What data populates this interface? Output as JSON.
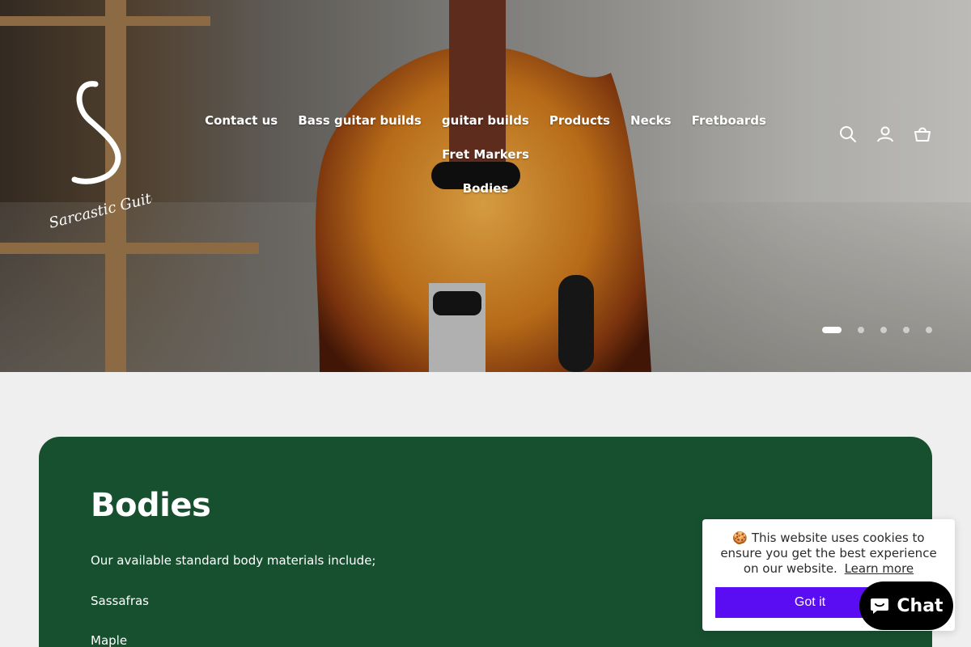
{
  "brand": {
    "logo_text": "Sarcastic Guitars"
  },
  "nav": {
    "items": [
      "Contact us",
      "Bass guitar builds",
      "guitar builds",
      "Products",
      "Necks",
      "Fretboards",
      "Fret Markers",
      "Bodies"
    ]
  },
  "header_icons": [
    "search-icon",
    "account-icon",
    "cart-icon"
  ],
  "slider": {
    "count": 5,
    "active": 1
  },
  "content": {
    "title": "Bodies",
    "intro": "Our available standard body materials include;",
    "materials": [
      "Sassafras",
      "Maple"
    ]
  },
  "cookie_banner": {
    "emoji": "🍪",
    "text": "This website uses cookies to ensure you get the best experience on our website.",
    "link": "Learn more",
    "button": "Got it"
  },
  "chat": {
    "label": "Chat"
  },
  "colors": {
    "card_green": "#17502f",
    "button_purple": "#5a0cf2",
    "page_bg": "#efefef"
  }
}
